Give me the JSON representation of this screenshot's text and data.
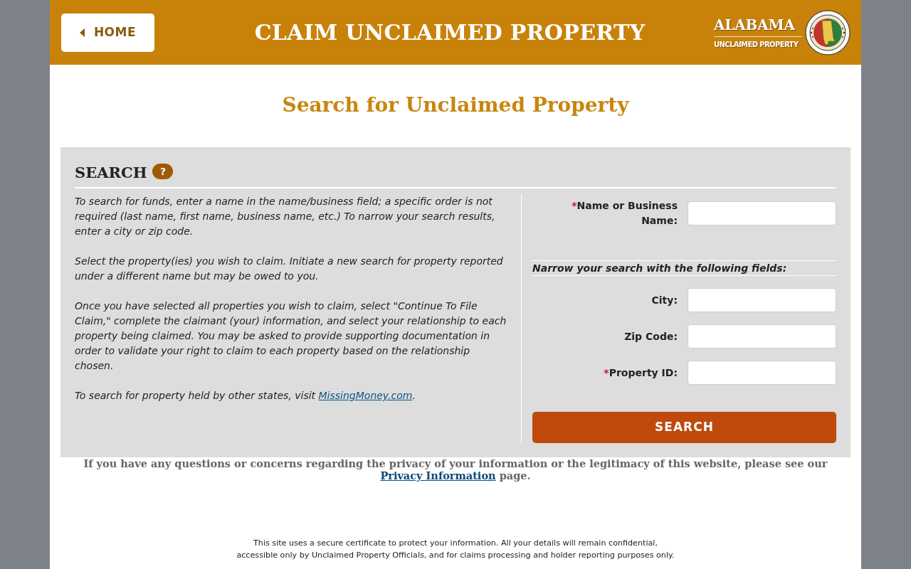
{
  "header": {
    "home_button": "HOME",
    "title": "CLAIM UNCLAIMED PROPERTY",
    "logo": {
      "name": "ALABAMA",
      "tagline": "UNCLAIMED PROPERTY"
    }
  },
  "page_title": "Search for Unclaimed Property",
  "search_panel": {
    "heading": "SEARCH",
    "help_badge": "?",
    "instructions": [
      {
        "text": "To search for funds, enter a name in the name/business field; a specific order is not required (last name, first name, business name, etc.) To narrow your search results, enter a city or zip code."
      },
      {
        "text": "Select the property(ies) you wish to claim. Initiate a new search for property reported under a different name but may be owed to you."
      },
      {
        "text": "Once you have selected all properties you wish to claim, select \"Continue To File Claim,\" complete the claimant (your) information, and select your relationship to each property being claimed. You may be asked to provide supporting documentation in order to validate your right to claim to each property based on the relationship chosen."
      },
      {
        "text": "To search for property held by other states, visit ",
        "link": "MissingMoney.com",
        "text_after": "."
      }
    ],
    "required_mark": "*",
    "primary_fields": [
      {
        "label": "Name or Business Name:",
        "required": true
      }
    ],
    "narrow_heading": "Narrow your search with the following fields:",
    "narrow_fields": [
      {
        "label": "City:",
        "required": false
      },
      {
        "label": "Zip Code:",
        "required": false
      },
      {
        "label": "Property ID:",
        "required": true
      }
    ],
    "search_button": "SEARCH"
  },
  "privacy_note": {
    "text": "If you have any questions or concerns regarding the privacy of your information or the legitimacy of this website, please see our ",
    "link": "Privacy Information",
    "text_after": " page."
  },
  "security_note": "This site uses a secure certificate to protect your information. All your details will remain confidential, accessible only by Unclaimed Property Officials, and for claims processing and holder reporting purposes only."
}
